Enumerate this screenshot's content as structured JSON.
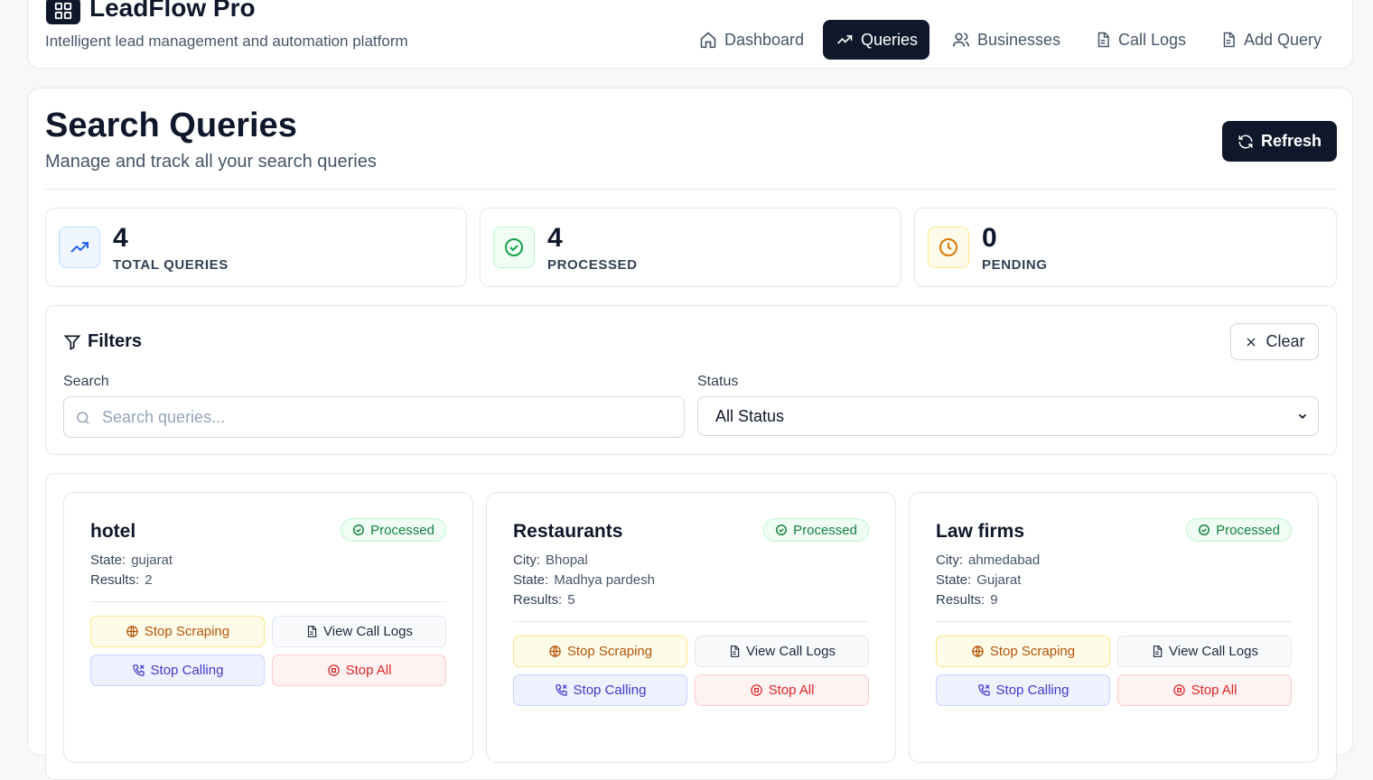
{
  "app": {
    "name": "LeadFlow Pro",
    "tagline": "Intelligent lead management and automation platform"
  },
  "nav": [
    {
      "label": "Dashboard",
      "icon": "home-icon",
      "active": false
    },
    {
      "label": "Queries",
      "icon": "trending-up-icon",
      "active": true
    },
    {
      "label": "Businesses",
      "icon": "users-icon",
      "active": false
    },
    {
      "label": "Call Logs",
      "icon": "document-icon",
      "active": false
    },
    {
      "label": "Add Query",
      "icon": "document-icon",
      "active": false
    }
  ],
  "page": {
    "title": "Search Queries",
    "subtitle": "Manage and track all your search queries",
    "refresh_label": "Refresh"
  },
  "stats": [
    {
      "value": "4",
      "label": "TOTAL QUERIES",
      "icon": "trending-up-icon",
      "color": "#2563eb"
    },
    {
      "value": "4",
      "label": "PROCESSED",
      "icon": "check-circle-icon",
      "color": "#16a34a"
    },
    {
      "value": "0",
      "label": "PENDING",
      "icon": "clock-icon",
      "color": "#d97706"
    }
  ],
  "filters": {
    "title": "Filters",
    "clear_label": "Clear",
    "search_label": "Search",
    "search_placeholder": "Search queries...",
    "search_value": "",
    "status_label": "Status",
    "status_value": "All Status"
  },
  "queries": [
    {
      "name": "hotel",
      "status": "Processed",
      "fields": [
        {
          "key": "State:",
          "value": "gujarat"
        },
        {
          "key": "Results:",
          "value": "2"
        }
      ]
    },
    {
      "name": "Restaurants",
      "status": "Processed",
      "fields": [
        {
          "key": "City:",
          "value": "Bhopal"
        },
        {
          "key": "State:",
          "value": "Madhya pardesh"
        },
        {
          "key": "Results:",
          "value": "5"
        }
      ]
    },
    {
      "name": "Law firms",
      "status": "Processed",
      "fields": [
        {
          "key": "City:",
          "value": "ahmedabad"
        },
        {
          "key": "State:",
          "value": "Gujarat"
        },
        {
          "key": "Results:",
          "value": "9"
        }
      ]
    }
  ],
  "actions": {
    "stop_scraping": "Stop Scraping",
    "view_call_logs": "View Call Logs",
    "stop_calling": "Stop Calling",
    "stop_all": "Stop All"
  },
  "colors": {
    "primary": "#0f172a",
    "processed": "#15803d",
    "scrape": "#b45309",
    "call": "#4338ca",
    "stop": "#dc2626"
  }
}
